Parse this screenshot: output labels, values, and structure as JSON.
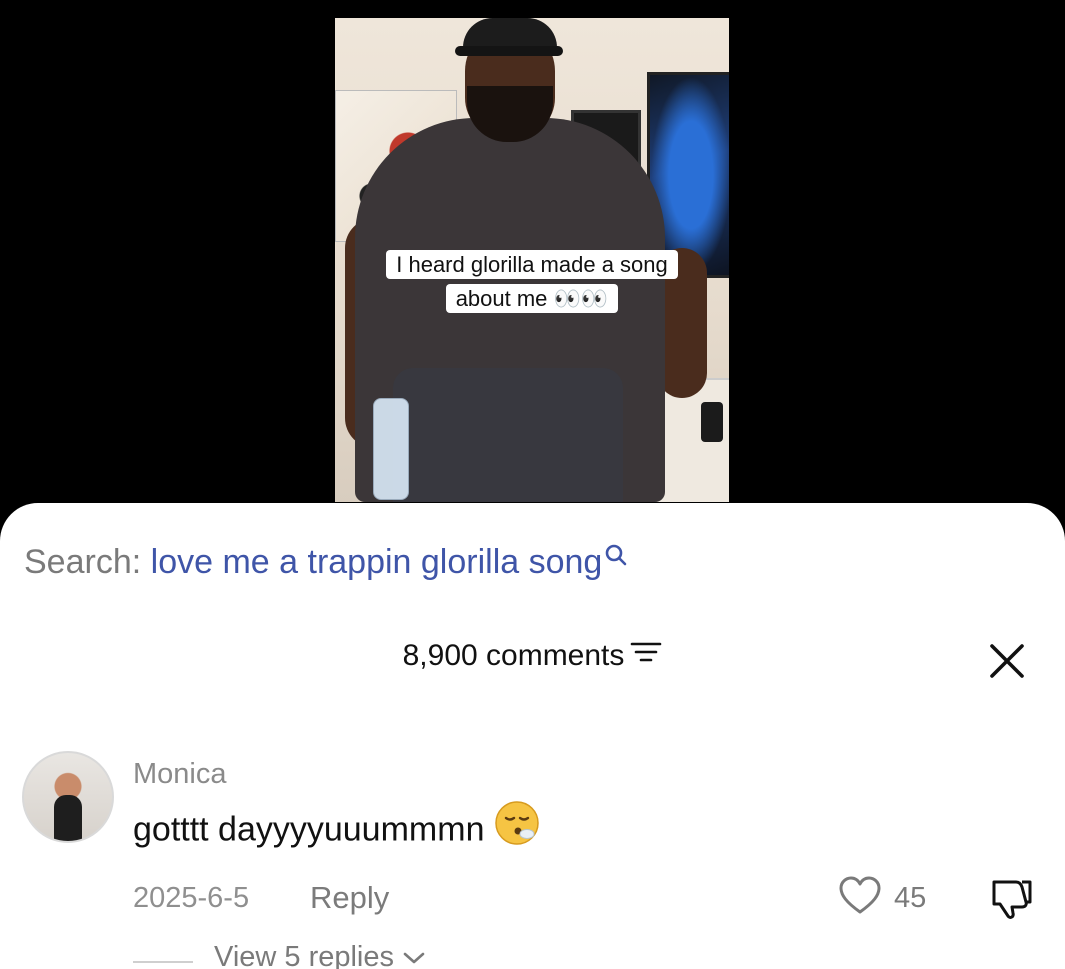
{
  "video": {
    "caption_line1": "I heard glorilla made a song",
    "caption_line2": "about me 👀👀"
  },
  "search": {
    "label": "Search:",
    "query": "love me a trappin glorilla song"
  },
  "comments": {
    "count_label": "8,900 comments"
  },
  "comment": {
    "username": "Monica",
    "text": "gotttt dayyyyuuummmn",
    "date": "2025-6-5",
    "reply_label": "Reply",
    "likes": "45",
    "view_replies": "View 5 replies"
  },
  "colors": {
    "query": "#3f55a8",
    "muted": "#7a7a7a"
  },
  "icons": [
    "search-icon",
    "filter-icon",
    "close-icon",
    "heart-icon",
    "dislike-icon",
    "chevron-down-icon",
    "face-exhaling-emoji"
  ]
}
